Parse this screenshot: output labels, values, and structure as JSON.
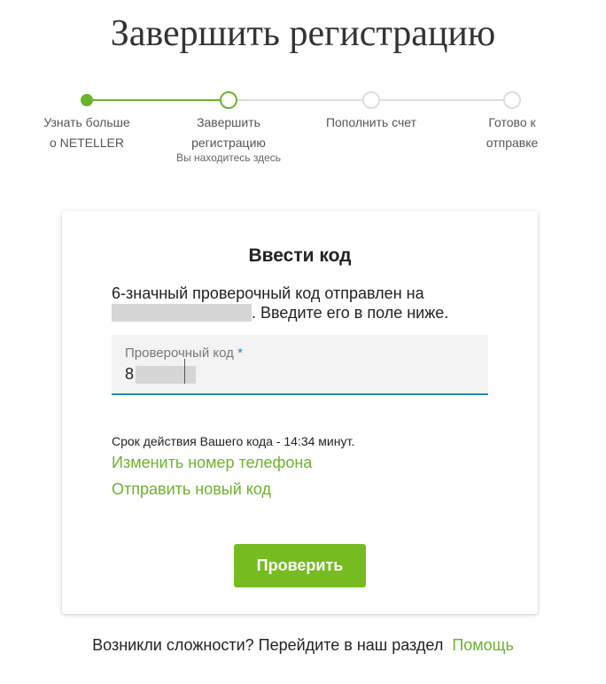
{
  "page": {
    "title": "Завершить регистрацию"
  },
  "stepper": {
    "steps": [
      {
        "label_line1": "Узнать больше",
        "label_line2": "о NETELLER",
        "state": "complete"
      },
      {
        "label_line1": "Завершить",
        "label_line2": "регистрацию",
        "state": "current",
        "sublabel": "Вы находитесь здесь"
      },
      {
        "label_line1": "Пополнить счет",
        "label_line2": "",
        "state": "future"
      },
      {
        "label_line1": "Готово к",
        "label_line2": "отправке",
        "state": "future"
      }
    ]
  },
  "card": {
    "title": "Ввести код",
    "desc_part1": "6-значный проверочный код отправлен на",
    "desc_part2": ". Введите его в поле ниже.",
    "code_field": {
      "label": "Проверочный код",
      "required_mark": "*",
      "value_visible": "8"
    },
    "expiry_text": "Срок действия Вашего кода - 14:34 минут.",
    "change_phone_link": "Изменить номер телефона",
    "resend_link": "Отправить новый код",
    "verify_button": "Проверить"
  },
  "footer": {
    "help_text": "Возникли сложности? Перейдите в наш раздел",
    "help_link": "Помощь"
  },
  "colors": {
    "accent_green": "#6cb32c",
    "button_green": "#76bc21",
    "focus_blue": "#2a8bb5",
    "inactive_gray": "#dddddd"
  }
}
